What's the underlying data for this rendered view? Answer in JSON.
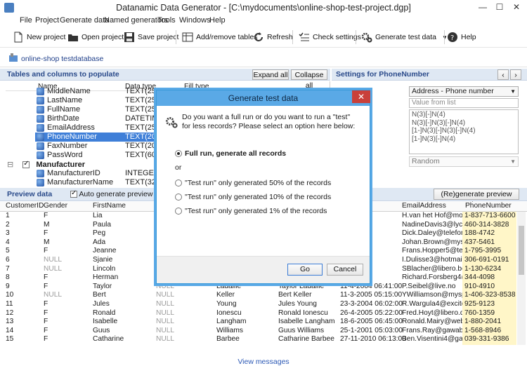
{
  "window": {
    "title": "Datanamic Data Generator - [C:\\mydocuments\\online-shop-test-project.dgp]"
  },
  "menu": [
    "File",
    "Project",
    "Generate data",
    "Named generators",
    "Tools",
    "Windows",
    "Help"
  ],
  "toolbar": {
    "new_project": "New project",
    "open_project": "Open project",
    "save_project": "Save project",
    "add_remove_tables": "Add/remove tables",
    "refresh": "Refresh",
    "check_settings": "Check settings",
    "generate_test_data": "Generate test data",
    "help": "Help"
  },
  "project": {
    "name": "online-shop testdatabase"
  },
  "tables_panel": {
    "title": "Tables and columns to populate",
    "expand_all": "Expand all",
    "collapse_all": "Collapse all",
    "headers": [
      "Name",
      "Data type",
      "Fill type"
    ],
    "rows": [
      {
        "name": "MiddleName",
        "type": "TEXT(255)"
      },
      {
        "name": "LastName",
        "type": "TEXT(255)"
      },
      {
        "name": "FullName",
        "type": "TEXT(255)"
      },
      {
        "name": "BirthDate",
        "type": "DATETIME"
      },
      {
        "name": "EmailAddress",
        "type": "TEXT(255)"
      },
      {
        "name": "PhoneNumber",
        "type": "TEXT(20)"
      },
      {
        "name": "FaxNumber",
        "type": "TEXT(20)"
      },
      {
        "name": "PassWord",
        "type": "TEXT(60)"
      },
      {
        "name": "Manufacturer",
        "type": ""
      },
      {
        "name": "ManufacturerID",
        "type": "INTEGER"
      },
      {
        "name": "ManufacturerName",
        "type": "TEXT(32)"
      }
    ]
  },
  "settings_panel": {
    "title": "Settings for PhoneNumber",
    "generator_select": "Address - Phone number",
    "value_from_list_placeholder": "Value from list",
    "patterns": [
      "N(3)[-]N(4)",
      "N(3)[-]N(3)[-]N(4)",
      "[1-]N(3)[-]N(3)[-]N(4)",
      "[1-]N(3)[-]N(4)"
    ],
    "order_select": "Random"
  },
  "preview": {
    "title": "Preview data",
    "auto_generate_label": "Auto generate preview data",
    "regenerate": "(Re)generate preview data",
    "columns": [
      "CustomerID",
      "Gender",
      "FirstName",
      "EmailAddress",
      "PhoneNumber"
    ],
    "rows": [
      {
        "id": "1",
        "gender": "F",
        "first": "Lia",
        "mid": "",
        "last": "",
        "full": "",
        "date": "0:42:00",
        "email": "H.van het Hof@mobile",
        "phone": "1-837-713-6600"
      },
      {
        "id": "2",
        "gender": "M",
        "first": "Paula",
        "mid": "",
        "last": "",
        "full": "",
        "date": "3:04:00",
        "email": "NadineDavis3@lycos.n",
        "phone": "460-314-3828"
      },
      {
        "id": "3",
        "gender": "F",
        "first": "Peg",
        "mid": "",
        "last": "",
        "full": "",
        "date": "7:14:00",
        "email": "Dick.Daley@telefonica.",
        "phone": "188-4742"
      },
      {
        "id": "4",
        "gender": "M",
        "first": "Ada",
        "mid": "",
        "last": "",
        "full": "",
        "date": "4:04:00",
        "email": "Johan.Brown@myspac",
        "phone": "437-5461"
      },
      {
        "id": "5",
        "gender": "F",
        "first": "Jeanne",
        "mid": "",
        "last": "",
        "full": "",
        "date": "",
        "email": "Frans.Hopper5@telefor",
        "phone": "1-795-3995"
      },
      {
        "id": "6",
        "gender": "NULL",
        "first": "Sjanie",
        "mid": "",
        "last": "",
        "full": "",
        "date": "0:51:00",
        "email": "I.Dulisse3@hotmail.nl",
        "phone": "306-691-0191"
      },
      {
        "id": "7",
        "gender": "NULL",
        "first": "Lincoln",
        "mid": "",
        "last": "",
        "full": "",
        "date": "2:47:00",
        "email": "SBlacher@libero.be",
        "phone": "1-130-6234"
      },
      {
        "id": "8",
        "gender": "F",
        "first": "Herman",
        "mid": "",
        "last": "",
        "full": "",
        "date": "4:41:00",
        "email": "Richard.Forsberg4@live",
        "phone": "344-4098"
      },
      {
        "id": "9",
        "gender": "F",
        "first": "Taylor",
        "mid": "NULL",
        "last": "Ladaille",
        "full": "Taylor  Ladaille",
        "date": "11-4-2004 06:41:00",
        "email": "P.Seibel@live.no",
        "phone": "910-4910"
      },
      {
        "id": "10",
        "gender": "NULL",
        "first": "Bert",
        "mid": "NULL",
        "last": "Keller",
        "full": "Bert  Keller",
        "date": "11-3-2005 05:15:00",
        "email": "YWilliamson@myspace",
        "phone": "1-406-323-8538"
      },
      {
        "id": "11",
        "gender": "F",
        "first": "Jules",
        "mid": "NULL",
        "last": "Young",
        "full": "Jules  Young",
        "date": "23-3-2004 06:02:00",
        "email": "R.Wargula4@excite.cn",
        "phone": "925-9123"
      },
      {
        "id": "12",
        "gender": "F",
        "first": "Ronald",
        "mid": "NULL",
        "last": "Ionescu",
        "full": "Ronald  Ionescu",
        "date": "26-4-2005 05:22:00",
        "email": "Fred.Hoyt@libero.dk",
        "phone": "760-1359"
      },
      {
        "id": "13",
        "gender": "F",
        "first": "Isabelle",
        "mid": "NULL",
        "last": "Langham",
        "full": "Isabelle  Langham",
        "date": "18-6-2005 06:45:00",
        "email": "Ronald.Mairy@webofft",
        "phone": "1-880-2041"
      },
      {
        "id": "14",
        "gender": "F",
        "first": "Guus",
        "mid": "NULL",
        "last": "Williams",
        "full": "Guus  Williams",
        "date": "25-1-2001 05:03:00",
        "email": "Frans.Ray@gawab.it",
        "phone": "1-568-8946"
      },
      {
        "id": "15",
        "gender": "F",
        "first": "Catharine",
        "mid": "NULL",
        "last": "Barbee",
        "full": "Catharine  Barbee",
        "date": "27-11-2010 06:13:00",
        "email": "Ben.Visentini4@gawab.c",
        "phone": "039-331-9386"
      }
    ],
    "view_messages": "View messages"
  },
  "dialog": {
    "title": "Generate test data",
    "question": "Do you want a full run or do you want to run a \"test\" for less records? Please select an option here below:",
    "options": [
      "Full run, generate all records",
      "\"Test run\" only generated 50% of the records",
      "\"Test run\" only generated 10% of the records",
      "\"Test run\" only generated 1% of the records"
    ],
    "or_label": "or",
    "go": "Go",
    "cancel": "Cancel"
  },
  "colors": {
    "accent": "#3a9ad9",
    "selection": "#3f7fd8",
    "panel_header": "#dfe8f3",
    "highlight_column": "#fff6c8"
  }
}
